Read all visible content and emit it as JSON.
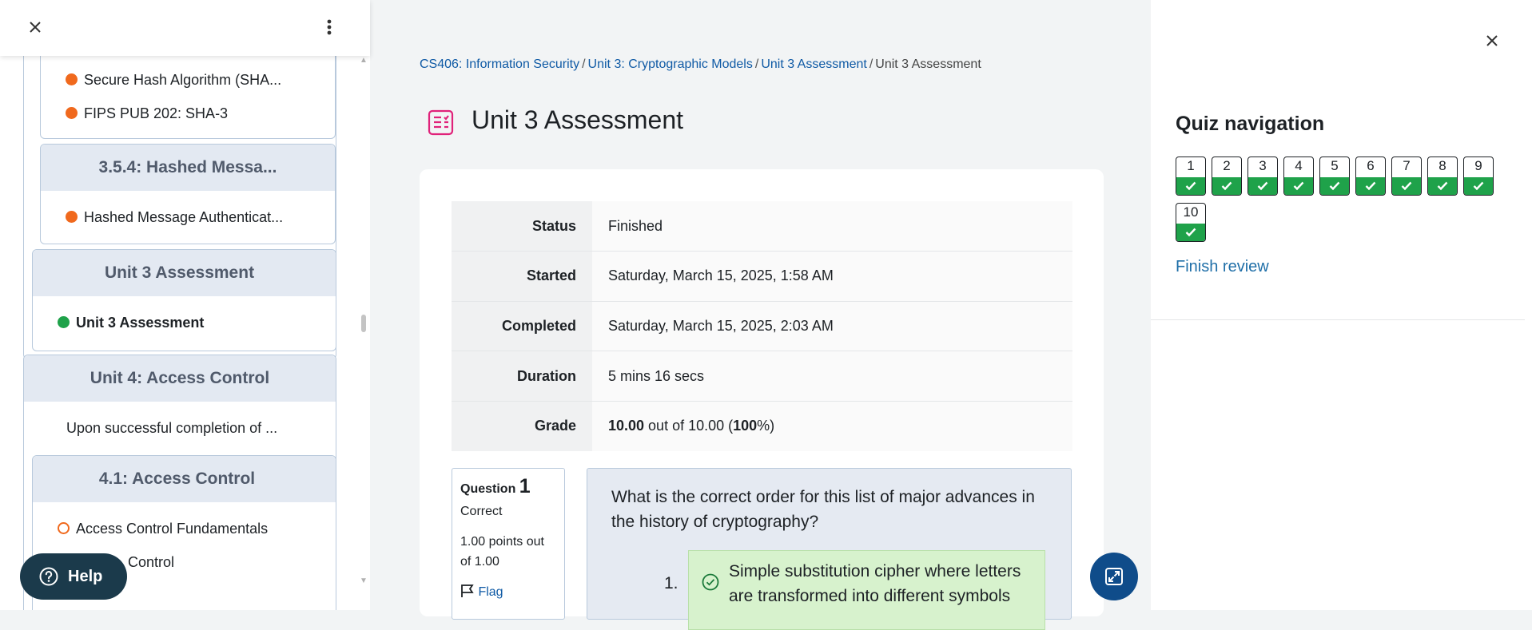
{
  "left_drawer": {
    "items": {
      "sha_fips": "Secure Hash Algorithm (SHA...",
      "sha3": "FIPS PUB 202: SHA-3",
      "section_354": "3.5.4: Hashed Messa...",
      "hmac": "Hashed Message Authenticat...",
      "unit3_assessment_header": "Unit 3 Assessment",
      "unit3_assessment_item": "Unit 3 Assessment",
      "unit4_header": "Unit 4: Access Control",
      "unit4_intro": "Upon successful completion of ...",
      "section_41": "4.1: Access Control",
      "ac_fundamentals": "Access Control Fundamentals",
      "ac_partial": "Control"
    },
    "help_label": "Help"
  },
  "breadcrumb": {
    "course": "CS406: Information Security",
    "unit": "Unit 3: Cryptographic Models",
    "section": "Unit 3 Assessment",
    "current": "Unit 3 Assessment",
    "sep": "/"
  },
  "page_title": "Unit 3 Assessment",
  "summary": {
    "status_label": "Status",
    "status_value": "Finished",
    "started_label": "Started",
    "started_value": "Saturday, March 15, 2025, 1:58 AM",
    "completed_label": "Completed",
    "completed_value": "Saturday, March 15, 2025, 2:03 AM",
    "duration_label": "Duration",
    "duration_value": "5 mins 16 secs",
    "grade_label": "Grade",
    "grade_score": "10.00",
    "grade_mid": " out of 10.00 (",
    "grade_pct": "100",
    "grade_end": "%)"
  },
  "question": {
    "label": "Question",
    "number": "1",
    "state": "Correct",
    "points": "1.00 points out of 1.00",
    "flag": "Flag",
    "text": "What is the correct order for this list of major advances in the history of cryptography?",
    "answer_num": "1.",
    "answer_text": "Simple substitution cipher where letters are transformed into different symbols"
  },
  "quiz_nav": {
    "title": "Quiz navigation",
    "questions": [
      "1",
      "2",
      "3",
      "4",
      "5",
      "6",
      "7",
      "8",
      "9",
      "10"
    ],
    "finish_review": "Finish review"
  },
  "colors": {
    "orange_dot": "#f0691d",
    "green_dot": "#1fa24a",
    "link": "#0f5aa5",
    "correct_bg": "#d7f2cd"
  }
}
